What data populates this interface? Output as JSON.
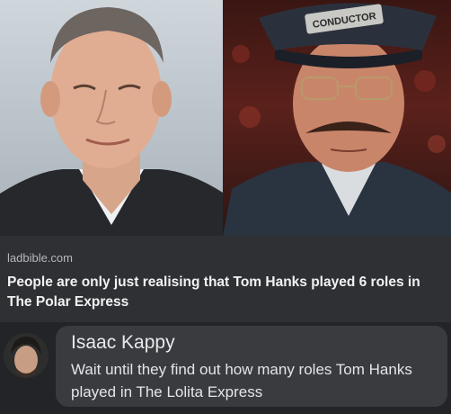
{
  "photos": {
    "right_cap_text": "CONDUCTOR"
  },
  "article": {
    "source": "ladbible.com",
    "headline": "People are only just realising that Tom Hanks played 6 roles in The Polar Express"
  },
  "comment": {
    "author": "Isaac Kappy",
    "text": "Wait until they find out how many roles Tom Hanks played in The Lolita Express"
  }
}
